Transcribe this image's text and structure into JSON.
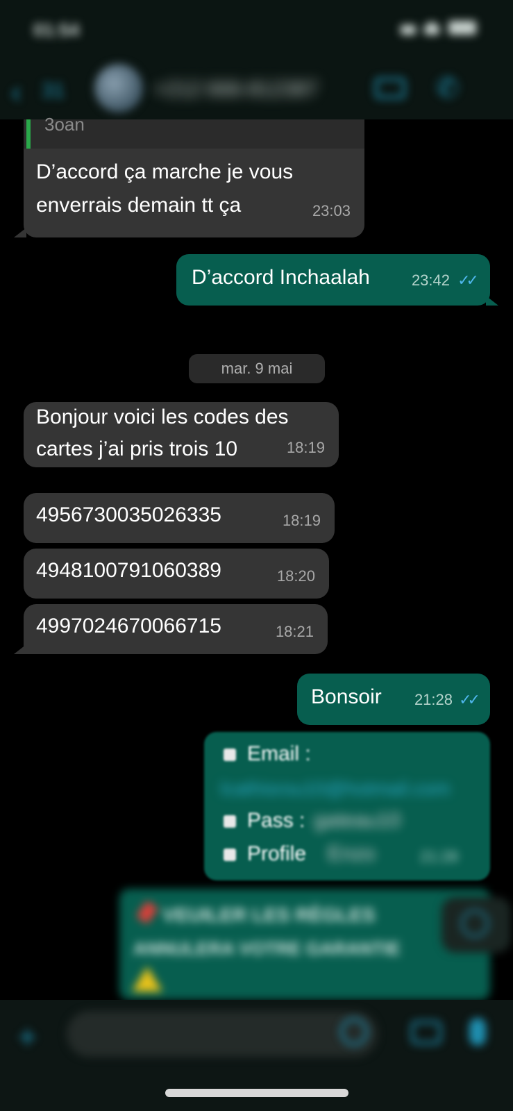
{
  "status_bar": {
    "time": "01:54"
  },
  "header": {
    "back_count": "31",
    "contact_name": "+212 666-812387"
  },
  "messages": [
    {
      "quote_sender": "3oan"
    },
    {
      "text_line1": "D’accord ça marche je vous",
      "text_line2": "enverrais demain tt ça",
      "time": "23:03"
    },
    {
      "text": "D’accord Inchaalah",
      "time": "23:42"
    },
    {
      "date": "mar. 9 mai"
    },
    {
      "text_line1": "Bonjour voici les codes des",
      "text_line2": "cartes j’ai pris trois 10",
      "time": "18:19"
    },
    {
      "text": "4956730035026335",
      "time": "18:19"
    },
    {
      "text": "4948100791060389",
      "time": "18:20"
    },
    {
      "text": "4997024670066715",
      "time": "18:21"
    },
    {
      "text": "Bonsoir",
      "time": "21:28"
    },
    {
      "email_label": "Email :",
      "email_value": "lcathisrou10@hotmail.com",
      "pass_label": "Pass :",
      "pass_value": "gateau10",
      "profile_label": "Profile",
      "profile_value": "Enzo",
      "time": "21:28"
    },
    {
      "line1": "VEUILER LES RÈGLES",
      "line2": "ANNULERA VOTRE GARANTIE"
    }
  ],
  "icons": {
    "back": "chevron-left",
    "video": "video-camera",
    "phone": "phone",
    "plus": "plus",
    "sticker": "sticker",
    "camera": "camera",
    "mic": "microphone",
    "read_receipt": "double-check",
    "warning": "warning-triangle"
  },
  "colors": {
    "incoming_bubble": "#353535",
    "outgoing_bubble": "#075e4f",
    "accent": "#1f8fb0",
    "read_tick": "#4fb6ec"
  }
}
